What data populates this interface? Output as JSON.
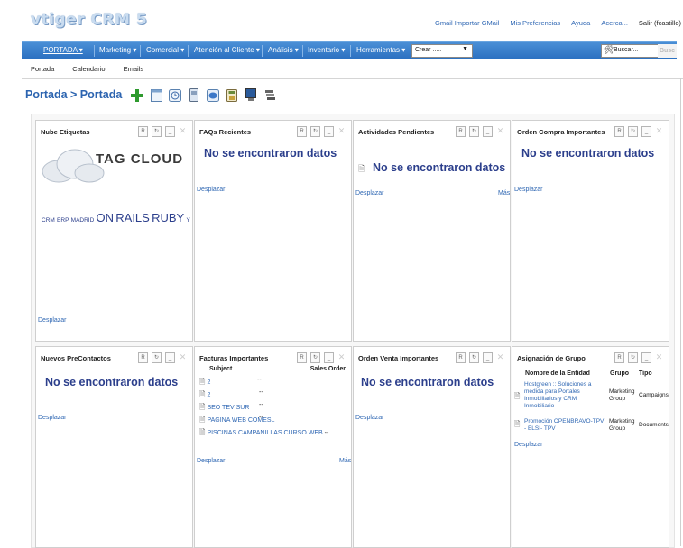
{
  "header": {
    "logo": "vtiger CRM 5",
    "links": [
      "Gmail Importar GMail",
      "Mis Preferencias",
      "Ayuda",
      "Acerca...",
      "Salir (fcastillo)"
    ]
  },
  "nav": {
    "items": [
      "PORTADA ▾",
      "Marketing ▾",
      "Comercial ▾",
      "Atención al Cliente ▾",
      "Análisis ▾",
      "Inventario ▾",
      "Herramientas ▾"
    ],
    "crear_value": "Crear .....",
    "search_placeholder": "Buscar...",
    "search_button": "Busc"
  },
  "subnav": [
    "Portada",
    "Calendario",
    "Emails"
  ],
  "breadcrumb": {
    "part1": "Portada",
    "sep": " > ",
    "part2": "Portada"
  },
  "toolbar_icons": [
    "add-icon",
    "calendar-icon",
    "clock-icon",
    "contacts-icon",
    "chat-icon",
    "calculator-icon",
    "screen-icon",
    "list-icon"
  ],
  "colors": {
    "nav_blue": "#2a6fc0",
    "link_blue": "#2f67b3",
    "title_blue": "#2c3f8c",
    "add_green": "#2e9a2e"
  },
  "common": {
    "no_data": "No se encontraron datos",
    "desplazar": "Desplazar",
    "mas": "Más"
  },
  "panels": {
    "tags": {
      "title": "Nube Etiquetas",
      "tagcloud_text": "TAG CLOUD",
      "tag_words": [
        "CRM",
        "ERP",
        "MADRID",
        "ON",
        "RAILS",
        "RUBY",
        "Y"
      ]
    },
    "faqs": {
      "title": "FAQs Recientes"
    },
    "activities": {
      "title": "Actividades Pendientes"
    },
    "purchase": {
      "title": "Orden Compra Importantes"
    },
    "leads": {
      "title": "Nuevos PreContactos"
    },
    "invoices": {
      "title": "Facturas Importantes",
      "headers": [
        "Subject",
        "Sales Order"
      ],
      "rows": [
        [
          "2",
          "--"
        ],
        [
          "2",
          "--"
        ],
        [
          "SEO TEVISUR",
          "--"
        ],
        [
          "PAGINA WEB COMESL",
          "--"
        ],
        [
          "PISCINAS CAMPANILLAS CURSO WEB",
          "--"
        ]
      ]
    },
    "sales": {
      "title": "Orden Venta Importantes"
    },
    "groups": {
      "title": "Asignación de Grupo",
      "headers": [
        "Nombre de la Entidad",
        "Grupo",
        "Tipo"
      ],
      "rows": [
        [
          "Hostgreen :: Soluciones a medida para Portales Inmobiliarios y CRM Inmobiliario",
          "Marketing Group",
          "Campaigns"
        ],
        [
          "Promoción OPENBRAVO-TPV - ELSI- TPV",
          "Marketing Group",
          "Documents"
        ]
      ]
    }
  }
}
